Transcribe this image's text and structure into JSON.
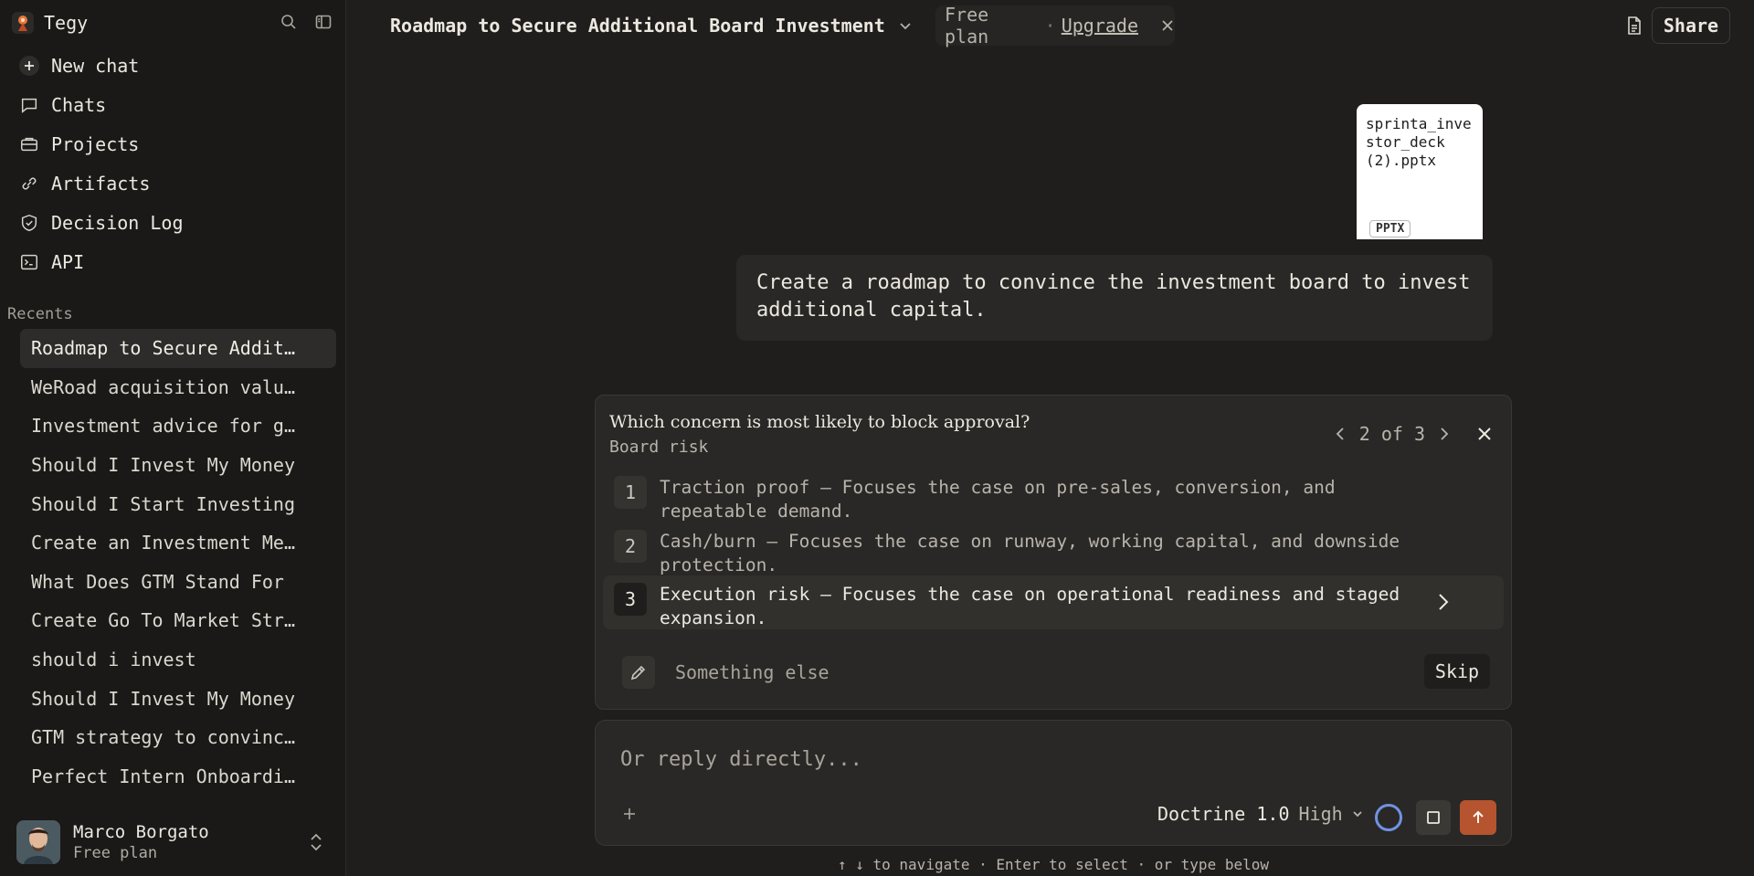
{
  "sidebar": {
    "brand": "Tegy",
    "nav": [
      {
        "label": "New chat",
        "icon": "plus-icon"
      },
      {
        "label": "Chats",
        "icon": "chat-bubble-icon"
      },
      {
        "label": "Projects",
        "icon": "briefcase-icon"
      },
      {
        "label": "Artifacts",
        "icon": "link-icon"
      },
      {
        "label": "Decision Log",
        "icon": "shield-icon"
      },
      {
        "label": "API",
        "icon": "terminal-icon"
      }
    ],
    "recents_label": "Recents",
    "recents": [
      "Roadmap to Secure Additional Board Investment",
      "WeRoad acquisition valuation",
      "Investment advice for good returns",
      "Should I Invest My Money",
      "Should I Start Investing",
      "Create an Investment Memo",
      "What Does GTM Stand For",
      "Create Go To Market Strategy",
      "should i invest",
      "Should I Invest My Money",
      "GTM strategy to convince investors",
      "Perfect Intern Onboarding Plan"
    ],
    "user": {
      "name": "Marco Borgato",
      "plan": "Free plan"
    }
  },
  "header": {
    "title": "Roadmap to Secure Additional Board Investment",
    "plan_label": "Free plan",
    "plan_separator": "·",
    "upgrade_label": "Upgrade",
    "share_label": "Share"
  },
  "attachment": {
    "name": "sprinta_investor_deck (2).pptx",
    "type": "PPTX"
  },
  "user_message": "Create a roadmap to convince the investment board to invest additional capital.",
  "question": {
    "title": "Which concern is most likely to block approval?",
    "subtitle": "Board risk",
    "pager": "2 of 3",
    "options": [
      {
        "num": "1",
        "text": "Traction proof — Focuses the case on pre-sales, conversion, and repeatable demand."
      },
      {
        "num": "2",
        "text": "Cash/burn — Focuses the case on runway, working capital, and downside protection."
      },
      {
        "num": "3",
        "text": "Execution risk — Focuses the case on operational readiness and staged expansion."
      }
    ],
    "something_else": "Something else",
    "skip_label": "Skip"
  },
  "composer": {
    "placeholder": "Or reply directly...",
    "model_name": "Doctrine 1.0",
    "model_level": "High"
  },
  "hint": "↑ ↓ to navigate · Enter to select · or type below",
  "colors": {
    "accent_send": "#b5542e",
    "ring": "#6f93e4"
  }
}
